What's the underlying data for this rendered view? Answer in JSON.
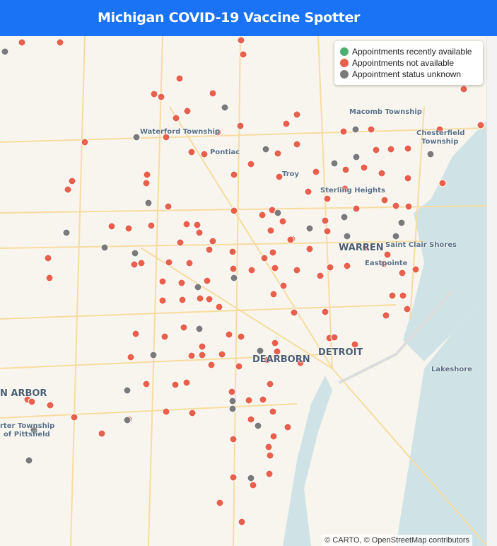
{
  "header": {
    "title": "Michigan COVID-19 Vaccine Spotter"
  },
  "legend": {
    "items": [
      {
        "label": "Appointments recently available",
        "color": "#4caf6e"
      },
      {
        "label": "Appointments not available",
        "color": "#e8604c"
      },
      {
        "label": "Appointment status unknown",
        "color": "#7a7a7a"
      }
    ]
  },
  "places": {
    "macomb": "Macomb Township",
    "chesterfield1": "Chesterfield",
    "chesterfield2": "Township",
    "waterford": "Waterford Township",
    "pontiac": "Pontiac",
    "troy": "Troy",
    "sterling": "Sterling Heights",
    "warren": "WARREN",
    "scs": "Saint Clair Shores",
    "eastpointe": "Eastpointe",
    "detroit": "DETROIT",
    "dearborn": "DEARBORN",
    "lakeshore": "Lakeshore",
    "annarbor": "N ARBOR",
    "pittsfield1": "rter Township",
    "pittsfield2": "of Pittsfield"
  },
  "attribution": "© CARTO, © OpenStreetMap contributors"
}
